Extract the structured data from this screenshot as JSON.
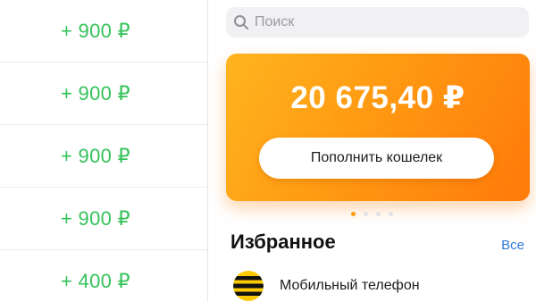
{
  "transactions": [
    {
      "amount": "+ 900 ₽"
    },
    {
      "amount": "+ 900 ₽"
    },
    {
      "amount": "+ 900 ₽"
    },
    {
      "amount": "+ 900 ₽"
    },
    {
      "amount": "+ 400 ₽"
    }
  ],
  "search": {
    "placeholder": "Поиск",
    "value": "",
    "icon": "search-icon"
  },
  "wallet": {
    "balance": "20 675,40 ₽",
    "topup_label": "Пополнить кошелек",
    "page_count": 4,
    "active_page": 1
  },
  "favorites": {
    "title": "Избранное",
    "all_label": "Все",
    "items": [
      {
        "label": "Мобильный телефон",
        "icon": "beeline-logo"
      }
    ]
  },
  "colors": {
    "income": "#35c25a",
    "card_start": "#ffb41f",
    "card_end": "#ff7a0a",
    "link": "#2f7ad9",
    "pager_active": "#ff9a12"
  }
}
